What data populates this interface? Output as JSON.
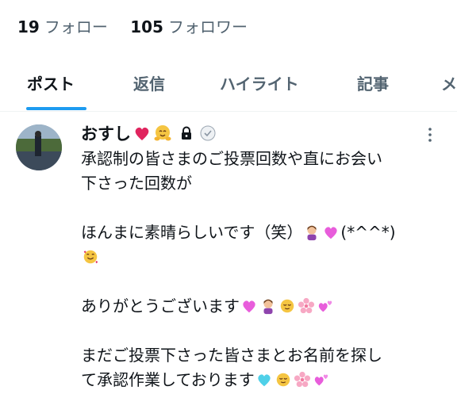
{
  "profile": {
    "following_count": "19",
    "following_label": "フォロー",
    "followers_count": "105",
    "followers_label": "フォロワー"
  },
  "tabs": [
    {
      "label": "ポスト",
      "active": true
    },
    {
      "label": "返信",
      "active": false
    },
    {
      "label": "ハイライト",
      "active": false
    },
    {
      "label": "記事",
      "active": false
    },
    {
      "label": "メ",
      "active": false
    }
  ],
  "colors": {
    "accent": "#1d9bf0",
    "text_primary": "#0f1419",
    "text_secondary": "#536471"
  },
  "post": {
    "author_name": "おすし",
    "name_emojis": [
      "red-heart-emoji",
      "hugging-face-emoji"
    ],
    "icons": [
      "lock-icon",
      "verified-badge-icon",
      "more-icon"
    ],
    "paragraphs": [
      {
        "lines": [
          "承認制の皆さまのご投票回数や直にお会い",
          "下さった回数が"
        ]
      },
      {
        "line1_text": "ほんまに素晴らしいです（笑）",
        "line1_suffix": "(*^^*)"
      },
      {
        "text": "ありがとうございます"
      },
      {
        "line1": "まだご投票下さった皆さまとお名前を探し",
        "line2": "て承認作業しております"
      }
    ]
  }
}
